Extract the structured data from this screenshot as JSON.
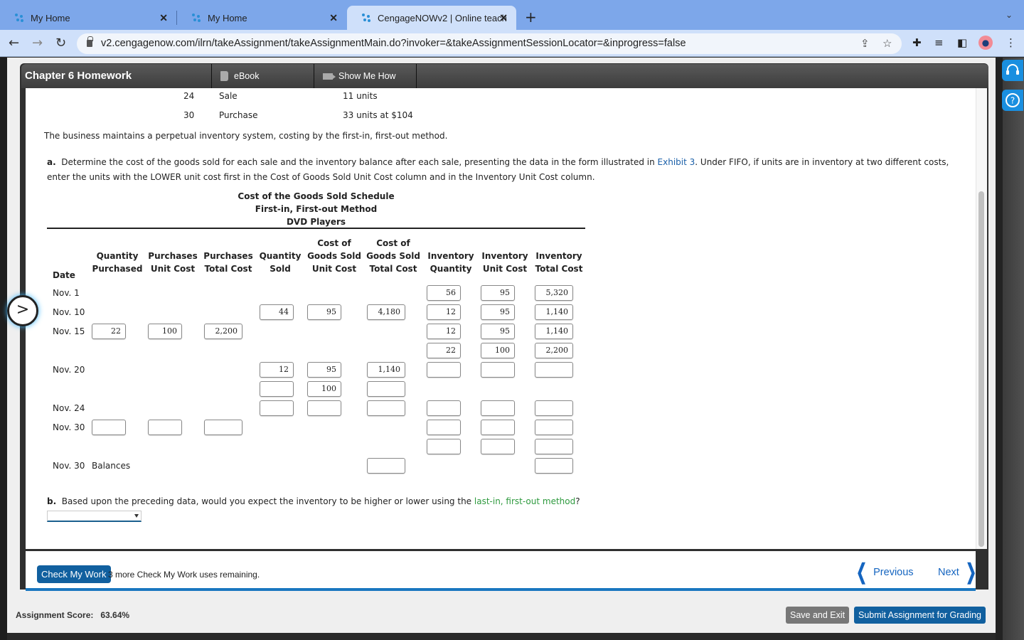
{
  "browser": {
    "tabs": [
      {
        "title": "My Home",
        "active": false
      },
      {
        "title": "My Home",
        "active": false
      },
      {
        "title": "CengageNOWv2 | Online teach",
        "active": true
      }
    ],
    "url": "v2.cengagenow.com/ilrn/takeAssignment/takeAssignmentMain.do?invoker=&takeAssignmentSessionLocator=&inprogress=false"
  },
  "header": {
    "title": "Chapter 6 Homework",
    "buttons": [
      "eBook",
      "Show Me How"
    ]
  },
  "problem": {
    "transactions": [
      {
        "day": "24",
        "type": "Sale",
        "detail": "11 units"
      },
      {
        "day": "30",
        "type": "Purchase",
        "detail": "33 units at $104"
      }
    ],
    "intro": "The business maintains a perpetual inventory system, costing by the first-in, first-out method.",
    "part_a_label": "a.",
    "part_a_text1": "Determine the cost of the goods sold for each sale and the inventory balance after each sale, presenting the data in the form illustrated in",
    "part_a_link": "Exhibit 3",
    "part_a_text2": ". Under FIFO, if units are in inventory at two different costs,",
    "part_a_text3": "enter the units with the LOWER unit cost first in the Cost of Goods Sold Unit Cost column and in the Inventory Unit Cost column.",
    "schedule_title": [
      "Cost of the Goods Sold Schedule",
      "First-in, First-out Method",
      "DVD Players"
    ],
    "columns": {
      "date": "Date",
      "qty_purchased": [
        "Quantity",
        "Purchased"
      ],
      "purch_unit_cost": [
        "Purchases",
        "Unit Cost"
      ],
      "purch_total_cost": [
        "Purchases",
        "Total Cost"
      ],
      "qty_sold": [
        "Quantity",
        "Sold"
      ],
      "cogs_unit_cost": [
        "Cost of",
        "Goods Sold",
        "Unit Cost"
      ],
      "cogs_total_cost": [
        "Cost of",
        "Goods Sold",
        "Total Cost"
      ],
      "inv_qty": [
        "Inventory",
        "Quantity"
      ],
      "inv_unit_cost": [
        "Inventory",
        "Unit Cost"
      ],
      "inv_total_cost": [
        "Inventory",
        "Total Cost"
      ]
    },
    "rows": {
      "nov1": {
        "date": "Nov. 1",
        "inv_qty": "56",
        "inv_unit": "95",
        "inv_total": "5,320"
      },
      "nov10": {
        "date": "Nov. 10",
        "qty_sold": "44",
        "cogs_unit": "95",
        "cogs_total": "4,180",
        "inv_qty": "12",
        "inv_unit": "95",
        "inv_total": "1,140"
      },
      "nov15": {
        "date": "Nov. 15",
        "qty_purch": "22",
        "purch_unit": "100",
        "purch_total": "2,200",
        "inv_qty": "12",
        "inv_unit": "95",
        "inv_total": "1,140",
        "inv_qty2": "22",
        "inv_unit2": "100",
        "inv_total2": "2,200"
      },
      "nov20": {
        "date": "Nov. 20",
        "qty_sold": "12",
        "cogs_unit": "95",
        "cogs_total": "1,140",
        "inv_qty": "",
        "inv_unit": "",
        "inv_total": "",
        "qty_sold2": "",
        "cogs_unit2": "100",
        "cogs_total2": ""
      },
      "nov24": {
        "date": "Nov. 24",
        "qty_sold": "",
        "cogs_unit": "",
        "cogs_total": "",
        "inv_qty": "",
        "inv_unit": "",
        "inv_total": ""
      },
      "nov30": {
        "date": "Nov. 30",
        "qty_purch": "",
        "purch_unit": "",
        "purch_total": "",
        "inv_qty": "",
        "inv_unit": "",
        "inv_total": "",
        "inv_qty2": "",
        "inv_unit2": "",
        "inv_total2": ""
      },
      "balances": {
        "date": "Nov. 30",
        "label": "Balances",
        "cogs_total": "",
        "inv_total": ""
      }
    },
    "part_b_label": "b.",
    "part_b_text": "Based upon the preceding data, would you expect the inventory to be higher or lower using the",
    "part_b_link": "last-in, first-out method",
    "part_b_end": "?",
    "part_b_select": ""
  },
  "footer": {
    "check_label": "Check My Work",
    "check_note": "3 more Check My Work uses remaining.",
    "previous": "Previous",
    "next": "Next"
  },
  "bottom": {
    "score_label": "Assignment Score:",
    "score_value": "63.64%",
    "save_label": "Save and Exit",
    "submit_label": "Submit Assignment for Grading"
  }
}
